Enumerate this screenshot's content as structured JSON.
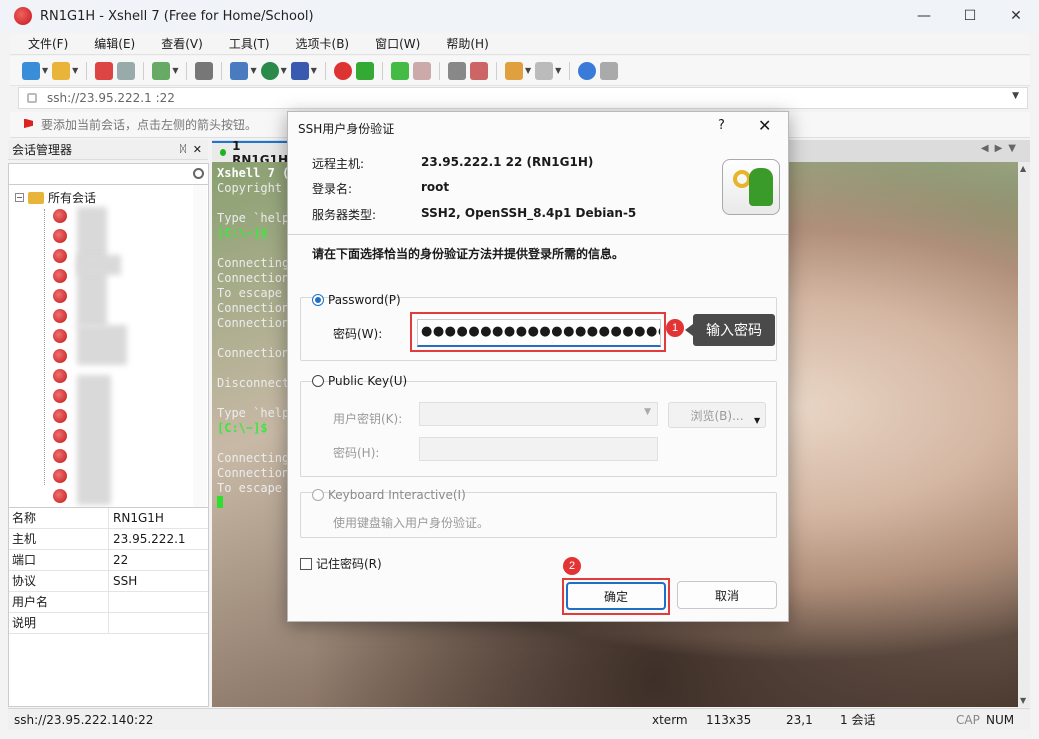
{
  "window": {
    "title": "RN1G1H - Xshell 7 (Free for Home/School)",
    "min": "—",
    "max": "☐",
    "close": "✕"
  },
  "menu": [
    "文件(F)",
    "编辑(E)",
    "查看(V)",
    "工具(T)",
    "选项卡(B)",
    "窗口(W)",
    "帮助(H)"
  ],
  "address": {
    "value": "ssh://23.95.222.1     :22"
  },
  "hint": {
    "text": "要添加当前会话，点击左侧的箭头按钮。"
  },
  "session_manager": {
    "title": "会话管理器",
    "pin": "ᛞ",
    "close": "✕",
    "root": "所有会话",
    "expand": "−"
  },
  "properties": [
    {
      "key": "名称",
      "value": "RN1G1H"
    },
    {
      "key": "主机",
      "value": "23.95.222.1"
    },
    {
      "key": "端口",
      "value": "22"
    },
    {
      "key": "协议",
      "value": "SSH"
    },
    {
      "key": "用户名",
      "value": ""
    },
    {
      "key": "说明",
      "value": ""
    }
  ],
  "terminal": {
    "tab_label": "1 RN1G1H",
    "lines": [
      "Xshell 7 (",
      "Copyright",
      "",
      "Type `help",
      "[C:\\~]$",
      "",
      "Connecting",
      "Connection",
      "To escape",
      "Connection",
      "Connection",
      "",
      "Connection",
      "",
      "Disconnect",
      "",
      "Type `help",
      "[C:\\~]$",
      "",
      "Connecting",
      "Connection",
      "To escape"
    ]
  },
  "statusbar": {
    "address": "ssh://23.95.222.140:22",
    "term": "xterm",
    "size": "113x35",
    "pos": "23,1",
    "sessions": "1 会话",
    "cap": "CAP",
    "num": "NUM"
  },
  "dialog": {
    "title": "SSH用户身份验证",
    "help": "?",
    "close": "✕",
    "remote_host_label": "远程主机:",
    "remote_host_value": "23.95.222.1      22 (RN1G1H)",
    "login_label": "登录名:",
    "login_value": "root",
    "server_type_label": "服务器类型:",
    "server_type_value": "SSH2, OpenSSH_8.4p1 Debian-5",
    "instruction": "请在下面选择恰当的身份验证方法并提供登录所需的信息。",
    "password_option": "Password(P)",
    "password_label": "密码(W):",
    "password_value": "●●●●●●●●●●●●●●●●●●●●●●●●●●●●",
    "publickey_option": "Public Key(U)",
    "user_key_label": "用户密钥(K):",
    "browse_label": "浏览(B)...",
    "passphrase_label": "密码(H):",
    "keyboard_option": "Keyboard Interactive(I)",
    "keyboard_desc": "使用键盘输入用户身份验证。",
    "remember_label": "记住密码(R)",
    "ok_label": "确定",
    "cancel_label": "取消"
  },
  "annotations": {
    "step1": "1",
    "step2": "2",
    "callout": "输入密码"
  }
}
